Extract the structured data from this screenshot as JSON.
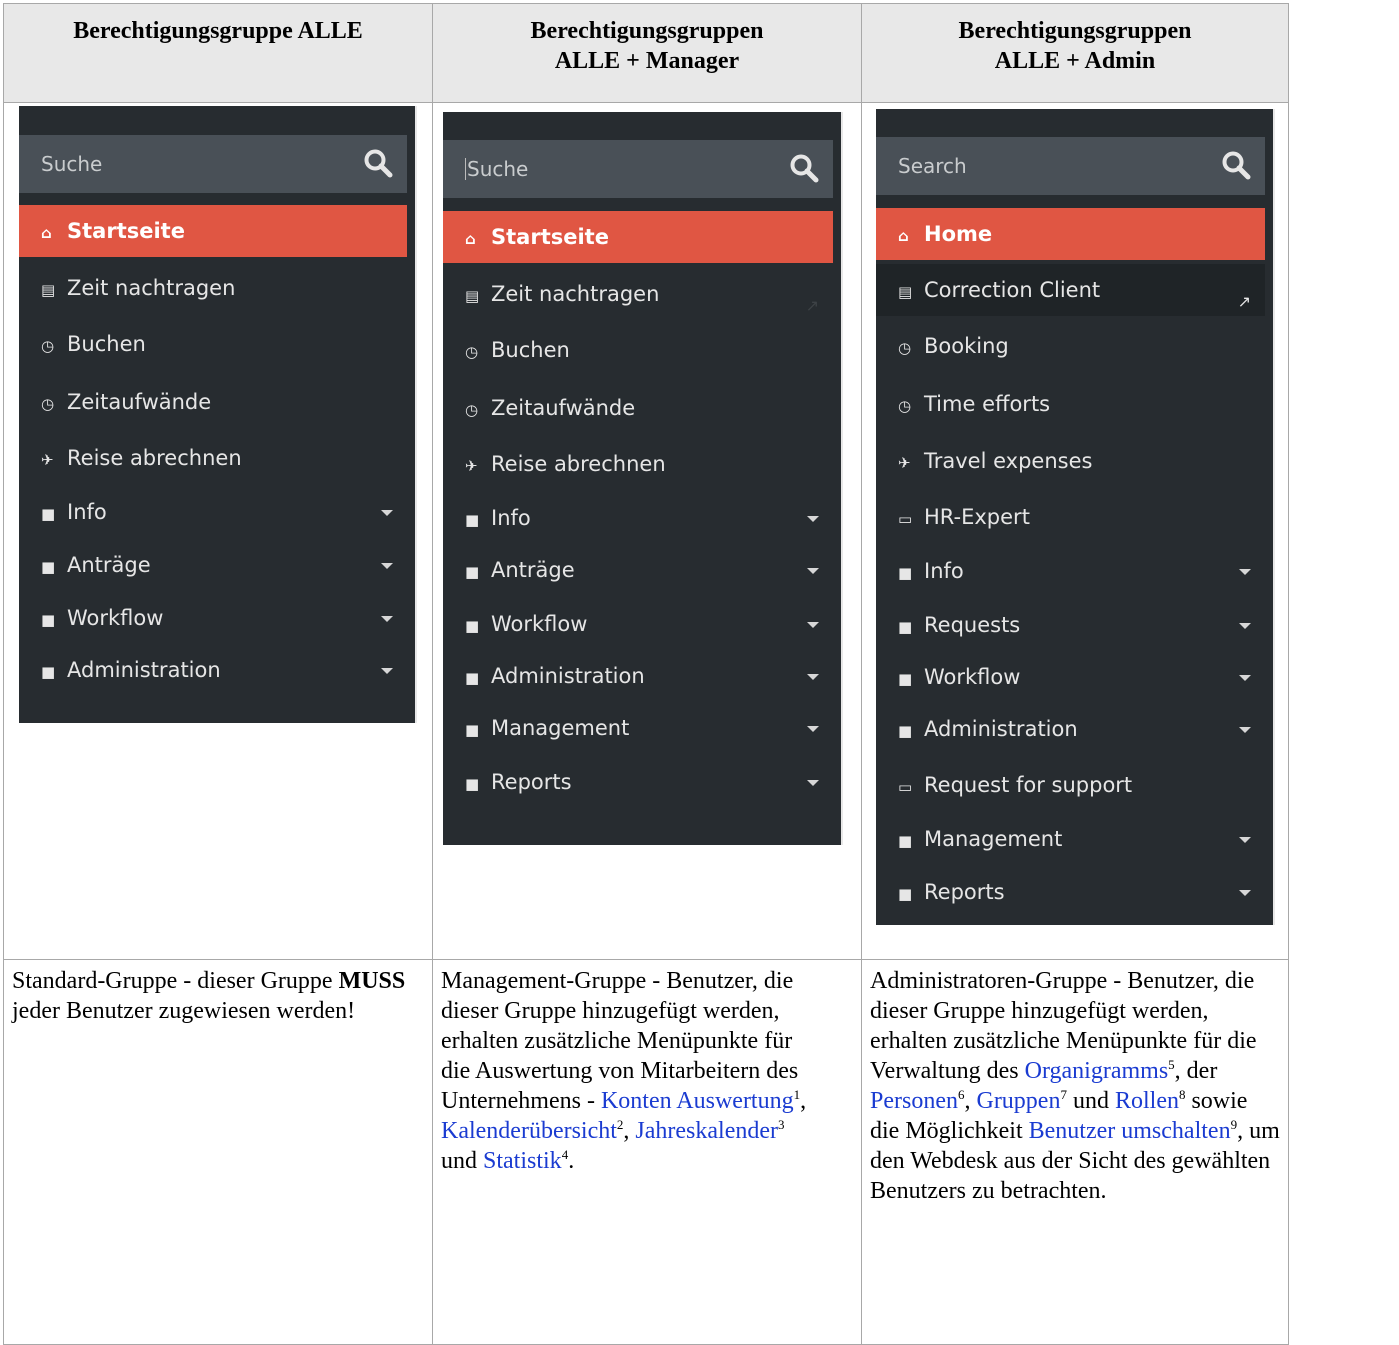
{
  "headers": {
    "col1": "Berechtigungsgruppe ALLE",
    "col2_line1": "Berechtigungsgruppen",
    "col2_line2": "ALLE + Manager",
    "col3_line1": "Berechtigungsgruppen",
    "col3_line2": "ALLE +  Admin"
  },
  "menu1": {
    "search_placeholder": "Suche",
    "items": [
      "Startseite",
      "Zeit nachtragen",
      "Buchen",
      "Zeitaufwände",
      "Reise abrechnen",
      "Info",
      "Anträge",
      "Workflow",
      "Administration"
    ]
  },
  "menu2": {
    "search_placeholder": "Suche",
    "items": [
      "Startseite",
      "Zeit nachtragen",
      "Buchen",
      "Zeitaufwände",
      "Reise abrechnen",
      "Info",
      "Anträge",
      "Workflow",
      "Administration",
      "Management",
      "Reports"
    ]
  },
  "menu3": {
    "search_placeholder": "Search",
    "items": [
      "Home",
      "Correction Client",
      "Booking",
      "Time efforts",
      "Travel expenses",
      "HR-Expert",
      "Info",
      "Requests",
      "Workflow",
      "Administration",
      "Request for support",
      "Management",
      "Reports"
    ]
  },
  "icons": {
    "home": "home-icon",
    "ledger": "keyboard-icon",
    "clock": "clock-icon",
    "plane": "plane-icon",
    "folder": "folder-icon",
    "monitor": "monitor-icon",
    "search": "search-icon",
    "external": "external-link-icon"
  },
  "colors": {
    "active": "#e05643",
    "panel": "#272c30",
    "search_bg": "#495057",
    "link": "#1a3bd1"
  },
  "desc1": {
    "t1": "Standard-Gruppe - dieser Gruppe ",
    "bold": "MUSS",
    "t2": " jeder Benutzer zugewiesen werden!"
  },
  "desc2": {
    "t1": "Management-Gruppe - Benutzer, die dieser Gruppe hinzugefügt werden, erhalten zusätzliche Menüpunkte für die Auswertung von Mitarbeitern des Unternehmens - ",
    "l1": "Konten Auswertung",
    "s1": "1",
    "sep1": ", ",
    "l2": "Kalenderübersicht",
    "s2": "2",
    "sep2": ", ",
    "l3": "Jahreskalender",
    "s3": "3",
    "sep3": " und ",
    "l4": "Statistik",
    "s4": "4",
    "end": "."
  },
  "desc3": {
    "t1": "Administratoren-Gruppe - Benutzer, die dieser Gruppe hinzugefügt werden, erhalten zusätzliche Menüpunkte für die Verwaltung des ",
    "l1": "Organigramms",
    "s1": "5",
    "t2": ", der ",
    "l2": "Personen",
    "s2": "6",
    "t3": ", ",
    "l3": "Gruppen",
    "s3": "7",
    "t4": " und ",
    "l4": "Rollen",
    "s4": "8",
    "t5": " sowie die Möglichkeit ",
    "l5": "Benutzer umschalten",
    "s5": "9",
    "t6": ", um den Webdesk aus der Sicht des gewählten Benutzers zu betrachten."
  }
}
